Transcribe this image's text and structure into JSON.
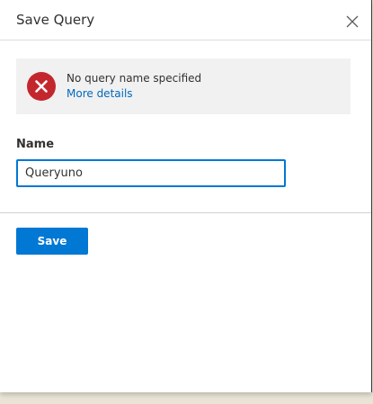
{
  "dialog": {
    "title": "Save Query",
    "close_icon": "close-icon"
  },
  "error": {
    "icon": "error-circle-icon",
    "message": "No query name specified",
    "link": "More details",
    "icon_color": "#c4262e",
    "link_color": "#0069bd"
  },
  "form": {
    "name_label": "Name",
    "name_value": "Queryuno"
  },
  "footer": {
    "save_label": "Save",
    "accent_color": "#0078d4"
  }
}
